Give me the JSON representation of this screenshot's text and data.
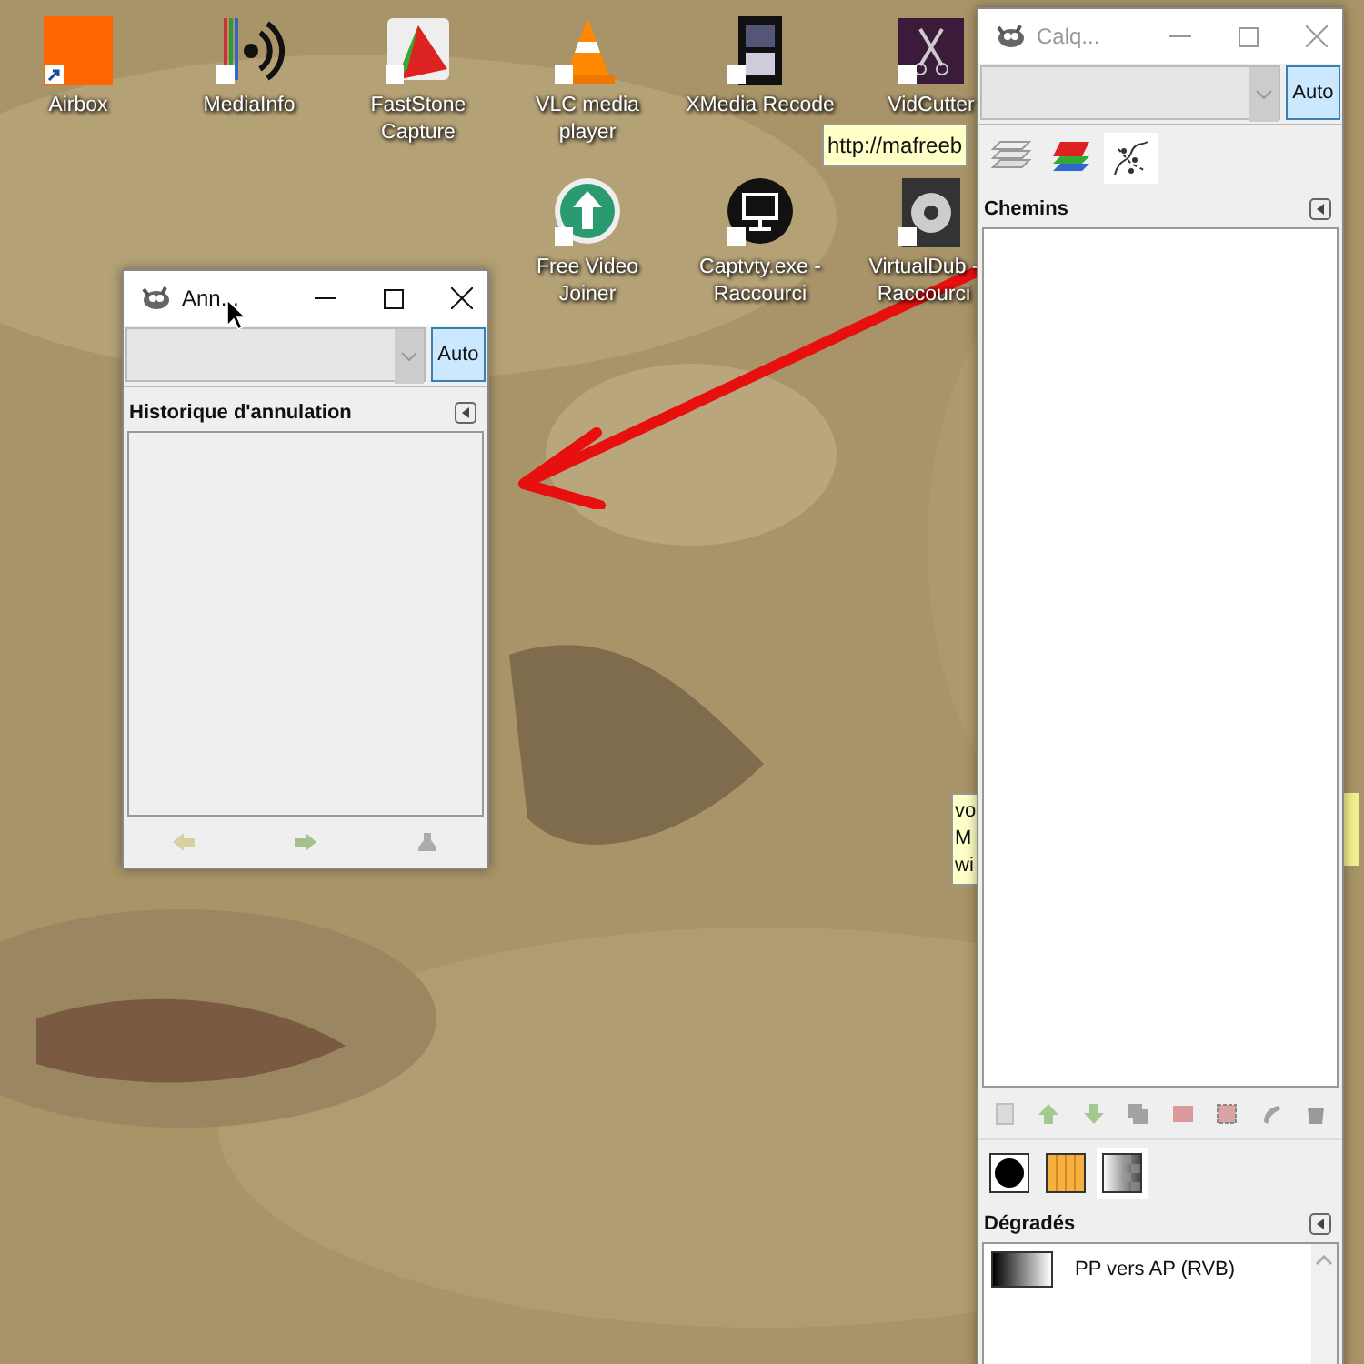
{
  "desktop_icons": [
    {
      "label": "Airbox"
    },
    {
      "label": "MediaInfo"
    },
    {
      "label": "FastStone Capture"
    },
    {
      "label": "VLC media player"
    },
    {
      "label": "XMedia Recode"
    },
    {
      "label": "VidCutter"
    },
    {
      "label": "Free Video Joiner"
    },
    {
      "label": "Captvty.exe - Raccourci"
    },
    {
      "label": "VirtualDub - Raccourci"
    }
  ],
  "tooltips": [
    {
      "lines": [
        "http://mafreeb"
      ]
    },
    {
      "lines": [
        "vo",
        "M",
        "wi"
      ]
    }
  ],
  "undo_window": {
    "title": "Ann...",
    "auto_button": {
      "label": "Auto",
      "selected": true
    },
    "panel_title": "Historique d'annulation",
    "buttons": [
      {
        "disabled": true
      },
      {
        "disabled": true
      },
      {
        "disabled": true
      }
    ]
  },
  "paths_window": {
    "title": "Calq...",
    "auto_button": {
      "label": "Auto",
      "selected": true
    },
    "tabs": [
      {
        "selected": false
      },
      {
        "selected": false
      },
      {
        "selected": true
      }
    ],
    "panel_title": "Chemins",
    "buttons": [
      {
        "disabled": true
      },
      {
        "disabled": true
      },
      {
        "disabled": true
      },
      {
        "disabled": true
      },
      {
        "disabled": true
      },
      {
        "disabled": true
      },
      {
        "disabled": true
      },
      {
        "disabled": true
      }
    ],
    "bottom_tabs": [
      {
        "selected": false
      },
      {
        "selected": false
      },
      {
        "selected": true
      }
    ],
    "gradients_panel": {
      "title": "Dégradés",
      "items": [
        {
          "name": "PP vers AP (RVB)"
        }
      ]
    }
  }
}
